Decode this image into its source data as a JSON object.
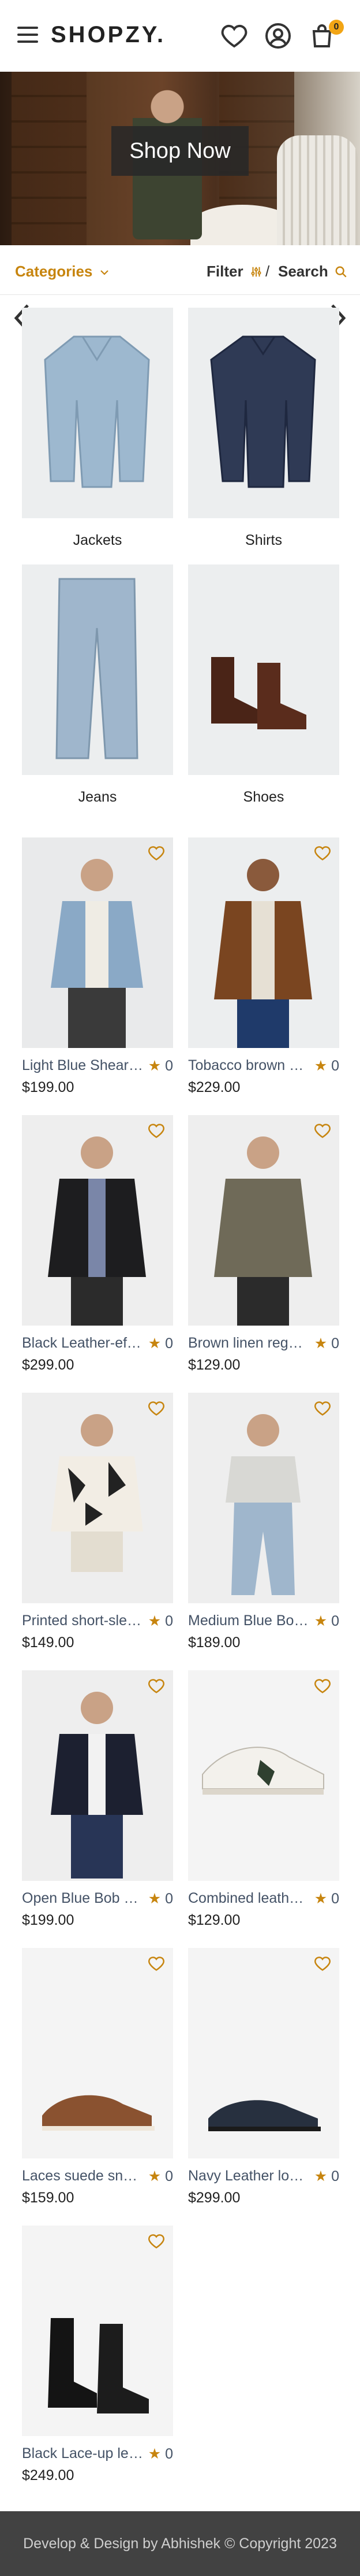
{
  "header": {
    "brand": "SHOPZY.",
    "cart_count": "0"
  },
  "hero": {
    "button_label": "Shop Now"
  },
  "filterbar": {
    "categories_label": "Categories",
    "filter_label": "Filter",
    "separator": "/",
    "search_label": "Search"
  },
  "categories": [
    {
      "label": "Jackets"
    },
    {
      "label": "Shirts"
    },
    {
      "label": "Jeans"
    },
    {
      "label": "Shoes"
    }
  ],
  "products": [
    {
      "name": "Light Blue Shearling-lined denim jacket",
      "rating": "0",
      "price": "$199.00"
    },
    {
      "name": "Tobacco brown corduroy overshirt",
      "rating": "0",
      "price": "$229.00"
    },
    {
      "name": "Black Leather-effect jacket",
      "rating": "0",
      "price": "$299.00"
    },
    {
      "name": "Brown linen regular-fit shirt",
      "rating": "0",
      "price": "$129.00"
    },
    {
      "name": "Printed short-sleeved shirt",
      "rating": "0",
      "price": "$149.00"
    },
    {
      "name": "Medium Blue Bootcut jeans",
      "rating": "0",
      "price": "$189.00"
    },
    {
      "name": "Open Blue Bob suit jacket",
      "rating": "0",
      "price": "$199.00"
    },
    {
      "name": "Combined leather sneakers",
      "rating": "0",
      "price": "$129.00"
    },
    {
      "name": "Laces suede sneakers",
      "rating": "0",
      "price": "$159.00"
    },
    {
      "name": "Navy Leather loafers",
      "rating": "0",
      "price": "$299.00"
    },
    {
      "name": "Black Lace-up leather boots",
      "rating": "0",
      "price": "$249.00"
    }
  ],
  "footer": {
    "text": "Develop & Design by Abhishek © Copyright 2023"
  },
  "colors": {
    "accent": "#c7850f",
    "cart_badge": "#f2a515",
    "footer_bg": "#424242"
  }
}
